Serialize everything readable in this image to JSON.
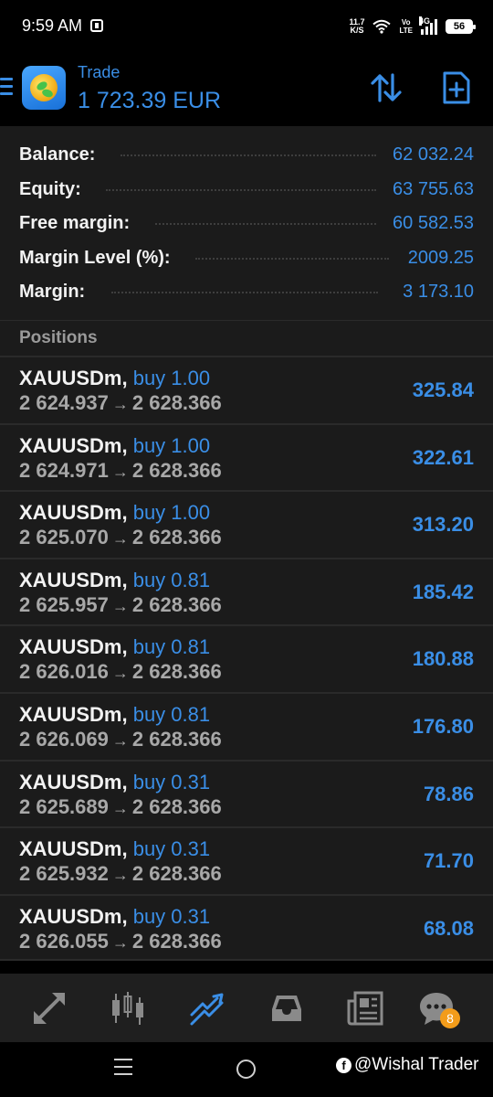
{
  "status_bar": {
    "time": "9:59 AM",
    "net_speed_value": "11.7",
    "net_speed_unit": "K/S",
    "volte_top": "Vo",
    "volte_bottom": "LTE",
    "network": "4G",
    "battery": "56"
  },
  "header": {
    "subtitle": "Trade",
    "title": "1 723.39 EUR"
  },
  "summary": [
    {
      "label": "Balance:",
      "value": "62 032.24"
    },
    {
      "label": "Equity:",
      "value": "63 755.63"
    },
    {
      "label": "Free margin:",
      "value": "60 582.53"
    },
    {
      "label": "Margin Level (%):",
      "value": "2009.25"
    },
    {
      "label": "Margin:",
      "value": "3 173.10"
    }
  ],
  "positions": {
    "title": "Positions",
    "arrow": "→",
    "items": [
      {
        "symbol": "XAUUSDm,",
        "type": "buy 1.00",
        "open": "2 624.937",
        "current": "2 628.366",
        "profit": "325.84"
      },
      {
        "symbol": "XAUUSDm,",
        "type": "buy 1.00",
        "open": "2 624.971",
        "current": "2 628.366",
        "profit": "322.61"
      },
      {
        "symbol": "XAUUSDm,",
        "type": "buy 1.00",
        "open": "2 625.070",
        "current": "2 628.366",
        "profit": "313.20"
      },
      {
        "symbol": "XAUUSDm,",
        "type": "buy 0.81",
        "open": "2 625.957",
        "current": "2 628.366",
        "profit": "185.42"
      },
      {
        "symbol": "XAUUSDm,",
        "type": "buy 0.81",
        "open": "2 626.016",
        "current": "2 628.366",
        "profit": "180.88"
      },
      {
        "symbol": "XAUUSDm,",
        "type": "buy 0.81",
        "open": "2 626.069",
        "current": "2 628.366",
        "profit": "176.80"
      },
      {
        "symbol": "XAUUSDm,",
        "type": "buy 0.31",
        "open": "2 625.689",
        "current": "2 628.366",
        "profit": "78.86"
      },
      {
        "symbol": "XAUUSDm,",
        "type": "buy 0.31",
        "open": "2 625.932",
        "current": "2 628.366",
        "profit": "71.70"
      },
      {
        "symbol": "XAUUSDm,",
        "type": "buy 0.31",
        "open": "2 626.055",
        "current": "2 628.366",
        "profit": "68.08"
      }
    ]
  },
  "bottom_nav": {
    "items": [
      {
        "name": "quotes",
        "icon": "quotes-arrows-icon",
        "active": false
      },
      {
        "name": "chart",
        "icon": "candlestick-icon",
        "active": false
      },
      {
        "name": "trade",
        "icon": "trade-trend-icon",
        "active": true
      },
      {
        "name": "history",
        "icon": "inbox-tray-icon",
        "active": false
      },
      {
        "name": "news",
        "icon": "newspaper-icon",
        "active": false
      },
      {
        "name": "messages",
        "icon": "chat-bubble-icon",
        "active": false
      }
    ],
    "messages_badge": "8"
  },
  "watermark": {
    "text": "@Wishal Trader"
  },
  "colors": {
    "accent": "#3a8ee6",
    "panel": "#1b1b1b",
    "divider": "#2a2a2a",
    "badge": "#f39c1a"
  }
}
